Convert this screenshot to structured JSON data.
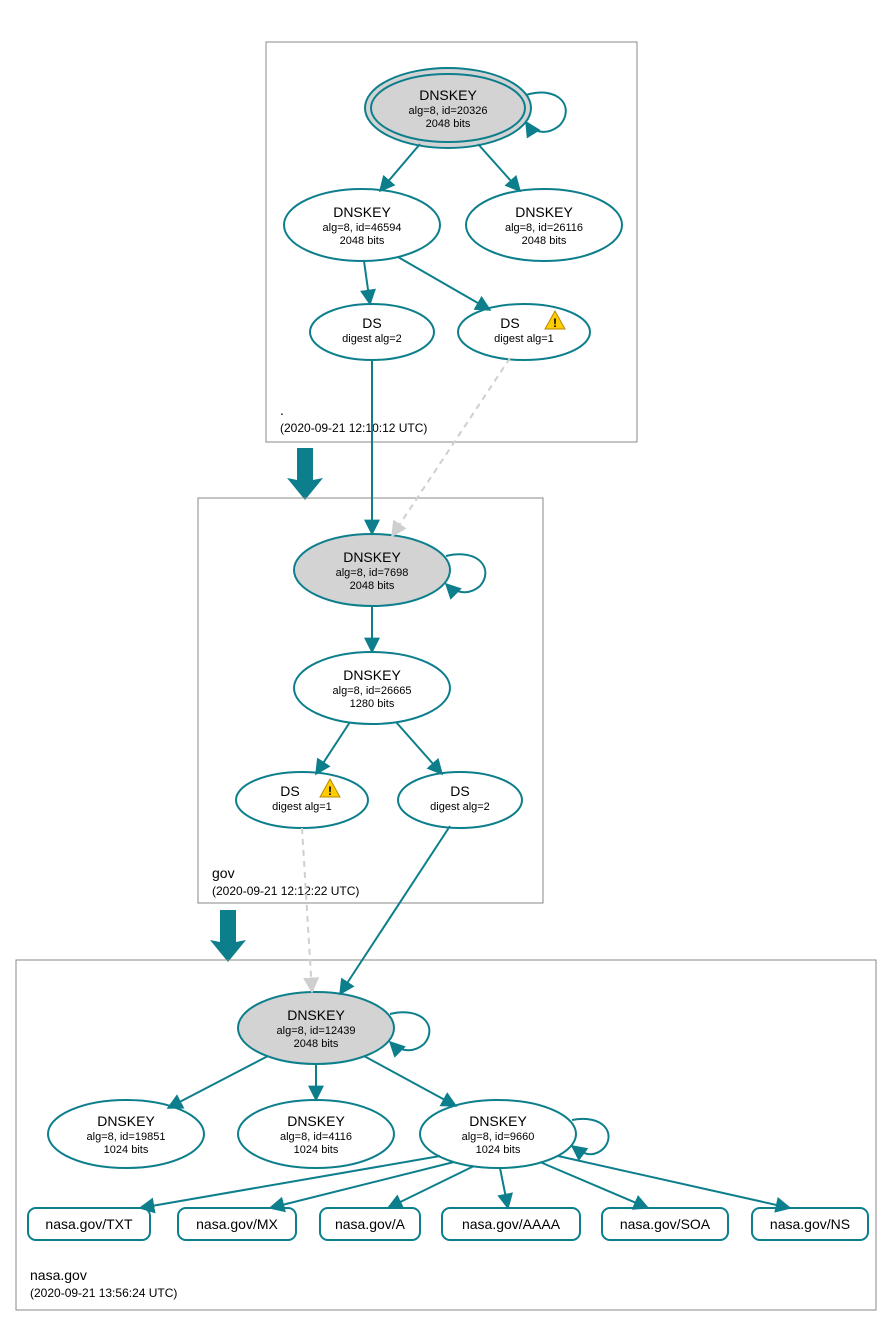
{
  "zones": {
    "root": {
      "title": ".",
      "time": "(2020-09-21 12:10:12 UTC)"
    },
    "gov": {
      "title": "gov",
      "time": "(2020-09-21 12:12:22 UTC)"
    },
    "nasa": {
      "title": "nasa.gov",
      "time": "(2020-09-21 13:56:24 UTC)"
    }
  },
  "nodes": {
    "root_ksk": {
      "title": "DNSKEY",
      "line2": "alg=8, id=20326",
      "line3": "2048 bits"
    },
    "root_zsk1": {
      "title": "DNSKEY",
      "line2": "alg=8, id=46594",
      "line3": "2048 bits"
    },
    "root_zsk2": {
      "title": "DNSKEY",
      "line2": "alg=8, id=26116",
      "line3": "2048 bits"
    },
    "root_ds2": {
      "title": "DS",
      "line2": "digest alg=2"
    },
    "root_ds1": {
      "title": "DS",
      "line2": "digest alg=1"
    },
    "gov_ksk": {
      "title": "DNSKEY",
      "line2": "alg=8, id=7698",
      "line3": "2048 bits"
    },
    "gov_zsk": {
      "title": "DNSKEY",
      "line2": "alg=8, id=26665",
      "line3": "1280 bits"
    },
    "gov_ds1": {
      "title": "DS",
      "line2": "digest alg=1"
    },
    "gov_ds2": {
      "title": "DS",
      "line2": "digest alg=2"
    },
    "nasa_ksk": {
      "title": "DNSKEY",
      "line2": "alg=8, id=12439",
      "line3": "2048 bits"
    },
    "nasa_zsk1": {
      "title": "DNSKEY",
      "line2": "alg=8, id=19851",
      "line3": "1024 bits"
    },
    "nasa_zsk2": {
      "title": "DNSKEY",
      "line2": "alg=8, id=4116",
      "line3": "1024 bits"
    },
    "nasa_zsk3": {
      "title": "DNSKEY",
      "line2": "alg=8, id=9660",
      "line3": "1024 bits"
    }
  },
  "rrsets": {
    "txt": "nasa.gov/TXT",
    "mx": "nasa.gov/MX",
    "a": "nasa.gov/A",
    "aaaa": "nasa.gov/AAAA",
    "soa": "nasa.gov/SOA",
    "ns": "nasa.gov/NS"
  }
}
